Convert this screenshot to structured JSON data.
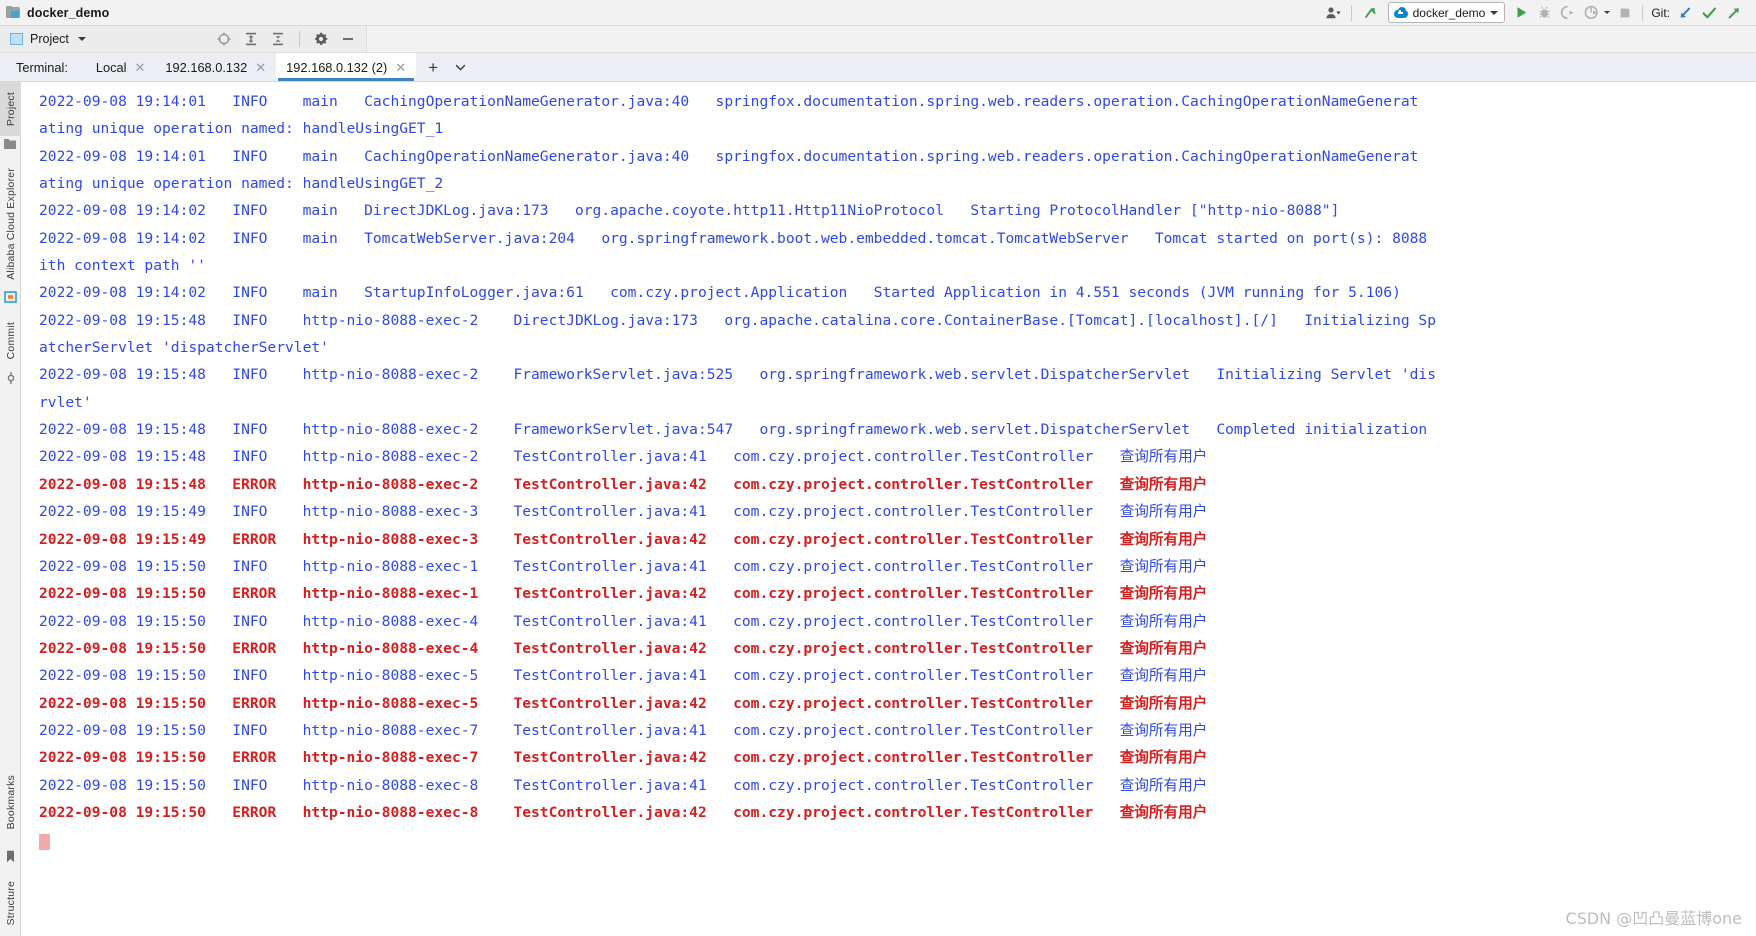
{
  "window": {
    "title": "docker_demo",
    "folder_icon": "project-folder-icon"
  },
  "toolbar": {
    "profile_icon": "user-profile-icon",
    "updates_icon": "green-arrow-up-icon",
    "run_config": {
      "label": "docker_demo",
      "icon": "cloud-run-config-icon"
    },
    "run_icon": "run-play-icon",
    "debug_icon": "debug-bug-icon",
    "run_coverage_icon": "run-with-coverage-icon",
    "profiler_icon": "profiler-icon",
    "stop_icon": "stop-square-icon",
    "git_label": "Git:",
    "git_update_icon": "git-update-arrow-icon",
    "git_commit_icon": "git-commit-check-icon",
    "git_push_icon": "git-push-arrow-icon"
  },
  "project_bar": {
    "label": "Project",
    "icon": "project-panel-icon",
    "dropdown_icon": "chevron-down-icon",
    "actions": [
      {
        "name": "select-opened-file-icon",
        "label": "Select Opened File"
      },
      {
        "name": "expand-all-icon",
        "label": "Expand All"
      },
      {
        "name": "collapse-all-icon",
        "label": "Collapse All"
      },
      {
        "name": "settings-gear-icon",
        "label": "Settings"
      },
      {
        "name": "hide-panel-icon",
        "label": "Hide"
      }
    ]
  },
  "terminal": {
    "title": "Terminal:",
    "tabs": [
      {
        "label": "Local",
        "active": false,
        "close_icon": "close-icon"
      },
      {
        "label": "192.168.0.132",
        "active": false,
        "close_icon": "close-icon"
      },
      {
        "label": "192.168.0.132 (2)",
        "active": true,
        "close_icon": "close-icon"
      }
    ],
    "add_label": "+",
    "add_icon": "add-tab-icon",
    "chevron_icon": "chevron-down-icon"
  },
  "sidebar": {
    "top_items": [
      {
        "label": "Project",
        "selected": true,
        "icon": "project-icon"
      },
      {
        "label": "Alibaba Cloud Explorer",
        "selected": false,
        "icon": "alibaba-cloud-icon"
      },
      {
        "label": "Commit",
        "selected": false,
        "icon": "commit-icon"
      }
    ],
    "bottom_items": [
      {
        "label": "Bookmarks",
        "selected": false,
        "icon": "bookmark-icon"
      },
      {
        "label": "Structure",
        "selected": false,
        "icon": "structure-icon"
      }
    ]
  },
  "console": {
    "text_color_info": "#2f48e8",
    "text_color_error": "#d42020",
    "cursor_color": "#f5aaaa",
    "lines": [
      {
        "level": "INFO",
        "text": "2022-09-08 19:14:01   INFO    main   CachingOperationNameGenerator.java:40   springfox.documentation.spring.web.readers.operation.CachingOperationNameGenerat"
      },
      {
        "level": "INFO",
        "text": "ating unique operation named: handleUsingGET_1"
      },
      {
        "level": "INFO",
        "text": "2022-09-08 19:14:01   INFO    main   CachingOperationNameGenerator.java:40   springfox.documentation.spring.web.readers.operation.CachingOperationNameGenerat"
      },
      {
        "level": "INFO",
        "text": "ating unique operation named: handleUsingGET_2"
      },
      {
        "level": "INFO",
        "text": "2022-09-08 19:14:02   INFO    main   DirectJDKLog.java:173   org.apache.coyote.http11.Http11NioProtocol   Starting ProtocolHandler [\"http-nio-8088\"]"
      },
      {
        "level": "INFO",
        "text": "2022-09-08 19:14:02   INFO    main   TomcatWebServer.java:204   org.springframework.boot.web.embedded.tomcat.TomcatWebServer   Tomcat started on port(s): 8088"
      },
      {
        "level": "INFO",
        "text": "ith context path ''"
      },
      {
        "level": "INFO",
        "text": "2022-09-08 19:14:02   INFO    main   StartupInfoLogger.java:61   com.czy.project.Application   Started Application in 4.551 seconds (JVM running for 5.106)"
      },
      {
        "level": "INFO",
        "text": "2022-09-08 19:15:48   INFO    http-nio-8088-exec-2    DirectJDKLog.java:173   org.apache.catalina.core.ContainerBase.[Tomcat].[localhost].[/]   Initializing Sp"
      },
      {
        "level": "INFO",
        "text": "atcherServlet 'dispatcherServlet'"
      },
      {
        "level": "INFO",
        "text": "2022-09-08 19:15:48   INFO    http-nio-8088-exec-2    FrameworkServlet.java:525   org.springframework.web.servlet.DispatcherServlet   Initializing Servlet 'dis"
      },
      {
        "level": "INFO",
        "text": "rvlet'"
      },
      {
        "level": "INFO",
        "text": "2022-09-08 19:15:48   INFO    http-nio-8088-exec-2    FrameworkServlet.java:547   org.springframework.web.servlet.DispatcherServlet   Completed initialization"
      },
      {
        "level": "INFO",
        "text": "2022-09-08 19:15:48   INFO    http-nio-8088-exec-2    TestController.java:41   com.czy.project.controller.TestController   查询所有用户"
      },
      {
        "level": "ERROR",
        "text": "2022-09-08 19:15:48   ERROR   http-nio-8088-exec-2    TestController.java:42   com.czy.project.controller.TestController   查询所有用户"
      },
      {
        "level": "INFO",
        "text": "2022-09-08 19:15:49   INFO    http-nio-8088-exec-3    TestController.java:41   com.czy.project.controller.TestController   查询所有用户"
      },
      {
        "level": "ERROR",
        "text": "2022-09-08 19:15:49   ERROR   http-nio-8088-exec-3    TestController.java:42   com.czy.project.controller.TestController   查询所有用户"
      },
      {
        "level": "INFO",
        "text": "2022-09-08 19:15:50   INFO    http-nio-8088-exec-1    TestController.java:41   com.czy.project.controller.TestController   查询所有用户"
      },
      {
        "level": "ERROR",
        "text": "2022-09-08 19:15:50   ERROR   http-nio-8088-exec-1    TestController.java:42   com.czy.project.controller.TestController   查询所有用户"
      },
      {
        "level": "INFO",
        "text": "2022-09-08 19:15:50   INFO    http-nio-8088-exec-4    TestController.java:41   com.czy.project.controller.TestController   查询所有用户"
      },
      {
        "level": "ERROR",
        "text": "2022-09-08 19:15:50   ERROR   http-nio-8088-exec-4    TestController.java:42   com.czy.project.controller.TestController   查询所有用户"
      },
      {
        "level": "INFO",
        "text": "2022-09-08 19:15:50   INFO    http-nio-8088-exec-5    TestController.java:41   com.czy.project.controller.TestController   查询所有用户"
      },
      {
        "level": "ERROR",
        "text": "2022-09-08 19:15:50   ERROR   http-nio-8088-exec-5    TestController.java:42   com.czy.project.controller.TestController   查询所有用户"
      },
      {
        "level": "INFO",
        "text": "2022-09-08 19:15:50   INFO    http-nio-8088-exec-7    TestController.java:41   com.czy.project.controller.TestController   查询所有用户"
      },
      {
        "level": "ERROR",
        "text": "2022-09-08 19:15:50   ERROR   http-nio-8088-exec-7    TestController.java:42   com.czy.project.controller.TestController   查询所有用户"
      },
      {
        "level": "INFO",
        "text": "2022-09-08 19:15:50   INFO    http-nio-8088-exec-8    TestController.java:41   com.czy.project.controller.TestController   查询所有用户"
      },
      {
        "level": "ERROR",
        "text": "2022-09-08 19:15:50   ERROR   http-nio-8088-exec-8    TestController.java:42   com.czy.project.controller.TestController   查询所有用户"
      }
    ]
  },
  "watermark": {
    "text": "CSDN @凹凸曼蓝博one"
  }
}
